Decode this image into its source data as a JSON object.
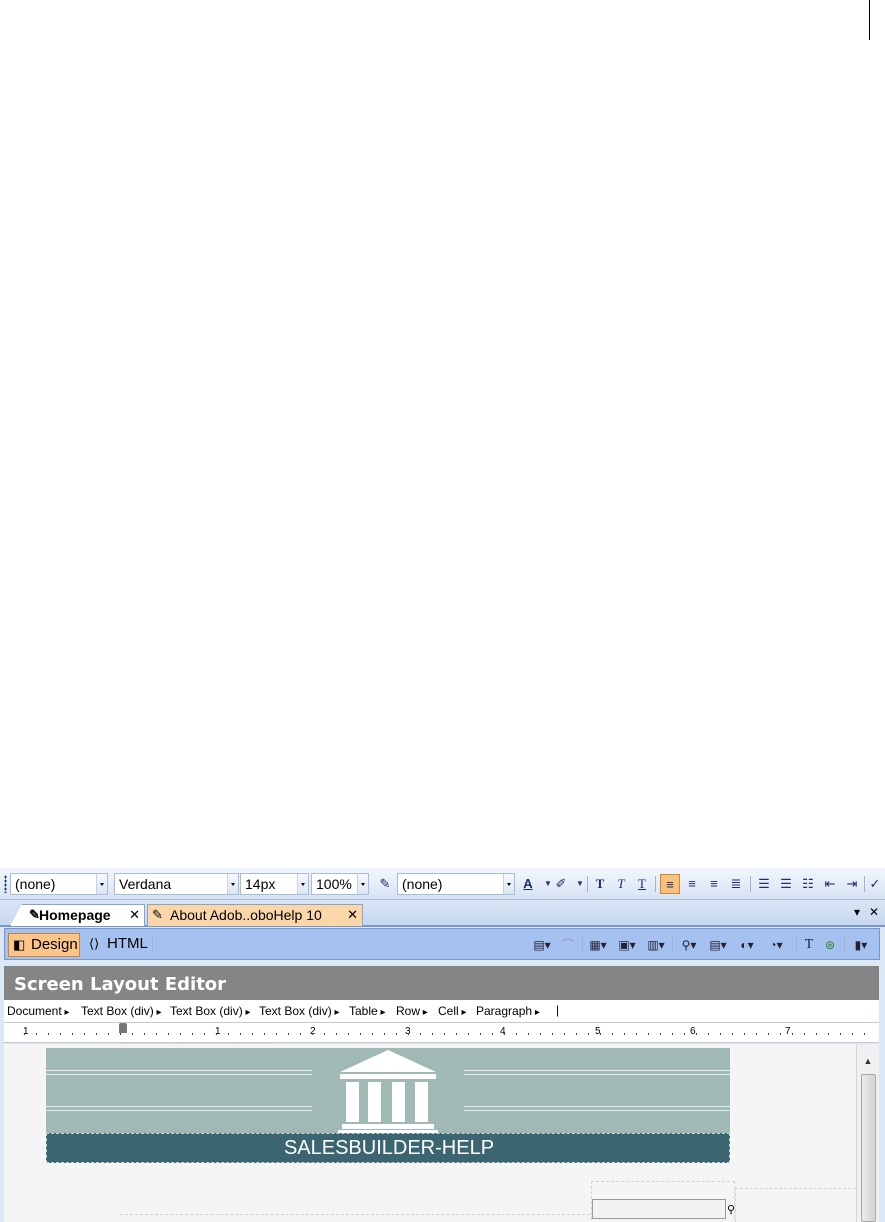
{
  "format_toolbar": {
    "style_combo": "(none)",
    "font_combo": "Verdana",
    "size_combo": "14px",
    "zoom_combo": "100%",
    "css_combo": "(none)",
    "icons": [
      "css-style-icon",
      "font-color-icon",
      "highlight-color-icon",
      "bold-icon",
      "italic-icon",
      "underline-icon",
      "align-left-icon",
      "align-center-icon",
      "align-right-icon",
      "justify-icon",
      "numbered-list-icon",
      "bulleted-list-icon",
      "multilevel-list-icon",
      "decrease-indent-icon",
      "increase-indent-icon",
      "spell-check-icon"
    ]
  },
  "tabs": [
    {
      "label": "Homepage",
      "close": "✕",
      "active": true
    },
    {
      "label": "About Adob..oboHelp 10",
      "close": "✕",
      "active": false
    }
  ],
  "tabstrip_controls": {
    "menu": "▾",
    "close": "✕"
  },
  "view_bar": {
    "design_label": "Design",
    "html_label": "HTML",
    "icons": [
      "insert-field-icon",
      "delete-icon",
      "table-icon",
      "form-icon",
      "document-icon",
      "find-icon",
      "show-icon",
      "dynamic-html-icon",
      "link-icon",
      "text-icon",
      "green-link-icon",
      "layout-icon"
    ]
  },
  "editor": {
    "title": "Screen Layout Editor",
    "breadcrumb": [
      "Document",
      "Text Box (div)",
      "Text Box (div)",
      "Text Box (div)",
      "Table",
      "Row",
      "Cell",
      "Paragraph"
    ],
    "breadcrumb_end": "|",
    "ruler_numbers": [
      "1",
      "1",
      "2",
      "3",
      "4",
      "5",
      "6",
      "7"
    ],
    "banner_title": "SALESBUILDER-HELP"
  },
  "colors": {
    "banner_bg": "#a0b9b5",
    "banner_title_bg": "#3b6671",
    "editor_header_bg": "#858585",
    "view_bar_bg": "#a5c1f0",
    "active_button": "#fbc58a"
  }
}
